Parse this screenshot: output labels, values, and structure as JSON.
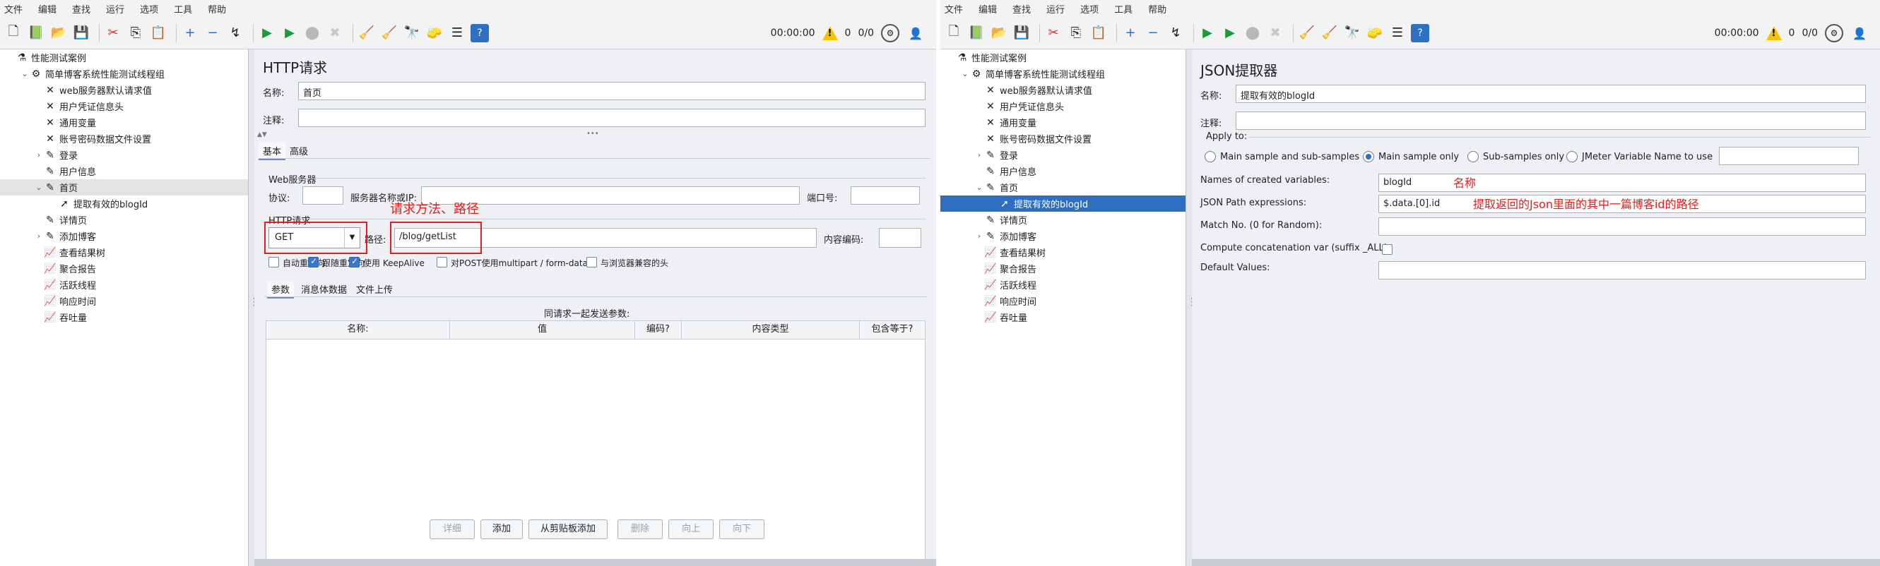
{
  "menu": [
    "文件",
    "编辑",
    "查找",
    "运行",
    "选项",
    "工具",
    "帮助"
  ],
  "status": {
    "timer": "00:00:00",
    "warnings": "0",
    "threads": "0/0"
  },
  "left_tree": [
    {
      "label": "性能测试案例",
      "depth": 0,
      "twisty": "",
      "icon": "flask-icon",
      "glyph": "⚗"
    },
    {
      "label": "简单博客系统性能测试线程组",
      "depth": 1,
      "twisty": "⌄",
      "icon": "gear-icon",
      "glyph": "⚙"
    },
    {
      "label": "web服务器默认请求值",
      "depth": 2,
      "twisty": "",
      "icon": "wrench-icon",
      "glyph": "✕"
    },
    {
      "label": "用户凭证信息头",
      "depth": 2,
      "twisty": "",
      "icon": "wrench-icon",
      "glyph": "✕"
    },
    {
      "label": "通用变量",
      "depth": 2,
      "twisty": "",
      "icon": "wrench-icon",
      "glyph": "✕"
    },
    {
      "label": "账号密码数据文件设置",
      "depth": 2,
      "twisty": "",
      "icon": "wrench-icon",
      "glyph": "✕"
    },
    {
      "label": "登录",
      "depth": 2,
      "twisty": "›",
      "icon": "pipette-icon",
      "glyph": "✎"
    },
    {
      "label": "用户信息",
      "depth": 2,
      "twisty": "",
      "icon": "pipette-icon",
      "glyph": "✎"
    },
    {
      "label": "首页",
      "depth": 2,
      "twisty": "⌄",
      "icon": "pipette-icon",
      "glyph": "✎",
      "selected": true
    },
    {
      "label": "提取有效的blogId",
      "depth": 3,
      "twisty": "",
      "icon": "extractor-icon",
      "glyph": "➚"
    },
    {
      "label": "详情页",
      "depth": 2,
      "twisty": "",
      "icon": "pipette-icon",
      "glyph": "✎"
    },
    {
      "label": "添加博客",
      "depth": 2,
      "twisty": "›",
      "icon": "pipette-icon",
      "glyph": "✎"
    },
    {
      "label": "查看结果树",
      "depth": 2,
      "twisty": "",
      "icon": "chart-icon",
      "glyph": "📈"
    },
    {
      "label": "聚合报告",
      "depth": 2,
      "twisty": "",
      "icon": "chart-icon",
      "glyph": "📈"
    },
    {
      "label": "活跃线程",
      "depth": 2,
      "twisty": "",
      "icon": "chart-icon",
      "glyph": "📈"
    },
    {
      "label": "响应时间",
      "depth": 2,
      "twisty": "",
      "icon": "chart-icon",
      "glyph": "📈"
    },
    {
      "label": "吞吐量",
      "depth": 2,
      "twisty": "",
      "icon": "chart-icon",
      "glyph": "📈"
    }
  ],
  "right_tree": [
    {
      "label": "性能测试案例",
      "depth": 0,
      "twisty": "",
      "icon": "flask-icon",
      "glyph": "⚗"
    },
    {
      "label": "简单博客系统性能测试线程组",
      "depth": 1,
      "twisty": "⌄",
      "icon": "gear-icon",
      "glyph": "⚙"
    },
    {
      "label": "web服务器默认请求值",
      "depth": 2,
      "twisty": "",
      "icon": "wrench-icon",
      "glyph": "✕"
    },
    {
      "label": "用户凭证信息头",
      "depth": 2,
      "twisty": "",
      "icon": "wrench-icon",
      "glyph": "✕"
    },
    {
      "label": "通用变量",
      "depth": 2,
      "twisty": "",
      "icon": "wrench-icon",
      "glyph": "✕"
    },
    {
      "label": "账号密码数据文件设置",
      "depth": 2,
      "twisty": "",
      "icon": "wrench-icon",
      "glyph": "✕"
    },
    {
      "label": "登录",
      "depth": 2,
      "twisty": "›",
      "icon": "pipette-icon",
      "glyph": "✎"
    },
    {
      "label": "用户信息",
      "depth": 2,
      "twisty": "",
      "icon": "pipette-icon",
      "glyph": "✎"
    },
    {
      "label": "首页",
      "depth": 2,
      "twisty": "⌄",
      "icon": "pipette-icon",
      "glyph": "✎"
    },
    {
      "label": "提取有效的blogId",
      "depth": 3,
      "twisty": "",
      "icon": "extractor-icon",
      "glyph": "➚",
      "selectedBlue": true
    },
    {
      "label": "详情页",
      "depth": 2,
      "twisty": "",
      "icon": "pipette-icon",
      "glyph": "✎"
    },
    {
      "label": "添加博客",
      "depth": 2,
      "twisty": "›",
      "icon": "pipette-icon",
      "glyph": "✎"
    },
    {
      "label": "查看结果树",
      "depth": 2,
      "twisty": "",
      "icon": "chart-icon",
      "glyph": "📈"
    },
    {
      "label": "聚合报告",
      "depth": 2,
      "twisty": "",
      "icon": "chart-icon",
      "glyph": "📈"
    },
    {
      "label": "活跃线程",
      "depth": 2,
      "twisty": "",
      "icon": "chart-icon",
      "glyph": "📈"
    },
    {
      "label": "响应时间",
      "depth": 2,
      "twisty": "",
      "icon": "chart-icon",
      "glyph": "📈"
    },
    {
      "label": "吞吐量",
      "depth": 2,
      "twisty": "",
      "icon": "chart-icon",
      "glyph": "📈"
    }
  ],
  "http": {
    "title": "HTTP请求",
    "name_label": "名称:",
    "name_value": "首页",
    "comment_label": "注释:",
    "comment_value": "",
    "tabs": [
      "基本",
      "高级"
    ],
    "web_server_label": "Web服务器",
    "protocol_label": "协议:",
    "server_label": "服务器名称或IP:",
    "port_label": "端口号:",
    "http_request_label": "HTTP请求",
    "method": "GET",
    "path_label": "路径:",
    "path_value": "/blog/getList",
    "encoding_label": "内容编码:",
    "checkboxes": [
      {
        "label": "自动重定向",
        "checked": false
      },
      {
        "label": "跟随重定向",
        "checked": true
      },
      {
        "label": "使用 KeepAlive",
        "checked": true
      },
      {
        "label": "对POST使用multipart / form-data",
        "checked": false
      },
      {
        "label": "与浏览器兼容的头",
        "checked": false
      }
    ],
    "param_tabs": [
      "参数",
      "消息体数据",
      "文件上传"
    ],
    "send_params_label": "同请求一起发送参数:",
    "columns": [
      "名称:",
      "值",
      "编码?",
      "内容类型",
      "包含等于?"
    ],
    "buttons": [
      {
        "label": "详细",
        "disabled": true
      },
      {
        "label": "添加",
        "disabled": false
      },
      {
        "label": "从剪贴板添加",
        "disabled": false
      },
      {
        "label": "删除",
        "disabled": true
      },
      {
        "label": "向上",
        "disabled": true
      },
      {
        "label": "向下",
        "disabled": true
      }
    ],
    "annotation": "请求方法、路径"
  },
  "json": {
    "title": "JSON提取器",
    "name_label": "名称:",
    "name_value": "提取有效的blogId",
    "comment_label": "注释:",
    "comment_value": "",
    "apply_to_label": "Apply to:",
    "radios": [
      {
        "label": "Main sample and sub-samples",
        "on": false
      },
      {
        "label": "Main sample only",
        "on": true
      },
      {
        "label": "Sub-samples only",
        "on": false
      },
      {
        "label": "JMeter Variable Name to use",
        "on": false
      }
    ],
    "var_names_label": "Names of created variables:",
    "var_names_value": "blogId",
    "var_names_annot": "名称",
    "path_label": "JSON Path expressions:",
    "path_value": "$.data.[0].id",
    "path_annot": "提取返回的Json里面的其中一篇博客id的路径",
    "match_label": "Match No. (0 for Random):",
    "match_value": "",
    "concat_label": "Compute concatenation var (suffix _ALL):",
    "default_label": "Default Values:",
    "default_value": ""
  },
  "colors": {
    "annotation": "#e02020",
    "selection": "#2f6fc1"
  }
}
